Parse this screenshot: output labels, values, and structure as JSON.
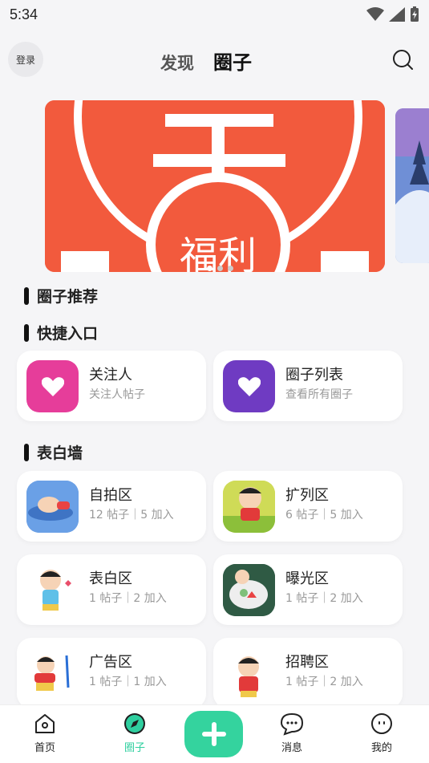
{
  "status_bar": {
    "time": "5:34"
  },
  "header": {
    "login_label": "登录",
    "tabs": [
      {
        "label": "发现"
      },
      {
        "label": "圈子"
      }
    ]
  },
  "banner": {
    "text": "福利"
  },
  "sections": {
    "recommend": "圈子推荐",
    "quick": "快捷入口",
    "wall": "表白墙"
  },
  "quick_entries": [
    {
      "title": "关注人",
      "sub": "关注人帖子",
      "color": "#e63d9a",
      "icon": "heart-icon"
    },
    {
      "title": "圈子列表",
      "sub": "查看所有圈子",
      "color": "#6f3bc2",
      "icon": "heart-icon"
    }
  ],
  "wall_items": [
    {
      "title": "自拍区",
      "sub": "12 帖子｜5 加入"
    },
    {
      "title": "扩列区",
      "sub": "6 帖子｜5 加入"
    },
    {
      "title": "表白区",
      "sub": "1 帖子｜2 加入"
    },
    {
      "title": "曝光区",
      "sub": "1 帖子｜2 加入"
    },
    {
      "title": "广告区",
      "sub": "1 帖子｜1 加入"
    },
    {
      "title": "招聘区",
      "sub": "1 帖子｜2 加入"
    }
  ],
  "bottom_nav": [
    {
      "label": "首页",
      "icon": "home-icon"
    },
    {
      "label": "圈子",
      "icon": "compass-icon"
    },
    {
      "label": "消息",
      "icon": "message-icon"
    },
    {
      "label": "我的",
      "icon": "profile-icon"
    }
  ],
  "colors": {
    "accent": "#34d39e",
    "banner": "#f25a3d"
  }
}
